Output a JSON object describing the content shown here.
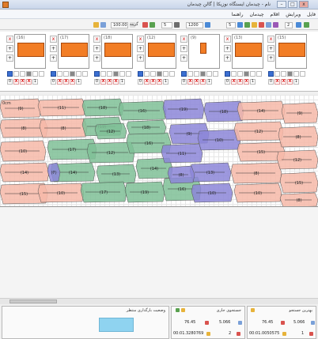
{
  "titlebar": {
    "title": "نام - چیدمان  ایستگاه  نوزیکا  | گالن چیدمان",
    "minimize": "–",
    "maximize": "□",
    "close": "x"
  },
  "menu": [
    "فایل",
    "ویرایش",
    "اقلام",
    "چیدمان",
    "راهنما"
  ],
  "toolbar": {
    "zoom_value": "100.00",
    "zoom_label": "گزینه",
    "field_2": "5",
    "field_3": "1200",
    "field_4": "5",
    "page_value": "2"
  },
  "pieces": [
    {
      "num": "(16)",
      "count_a": "0",
      "count_b": "1"
    },
    {
      "num": "(17)",
      "count_a": "0",
      "count_b": "1"
    },
    {
      "num": "(18)",
      "count_a": "0",
      "count_b": "1"
    },
    {
      "num": "(12)",
      "count_a": "0",
      "count_b": "1"
    },
    {
      "num": "(9)",
      "count_a": "0",
      "count_b": "1"
    },
    {
      "num": "(13)",
      "count_a": "0",
      "count_b": "1"
    },
    {
      "num": "(15)",
      "count_a": "0",
      "count_b": "1"
    }
  ],
  "marker": {
    "width_label": "0cm",
    "labels_salmon": [
      "(9)",
      "(8)",
      "(10)",
      "(14)",
      "(15)",
      "(11)",
      "(8)",
      "(10)",
      "(14)",
      "(12)",
      "(15)",
      "(8)",
      "(10)",
      "(9)",
      "(8)"
    ],
    "labels_green": [
      "(18)",
      "(19)",
      "(16)",
      "(17)",
      "(12)",
      "(14)",
      "(16)",
      "(13)",
      "(14)",
      "(17)",
      "(19)",
      "(18)",
      "(12)",
      "(16)"
    ],
    "labels_purple": [
      "(19)",
      "(18)",
      "(9)",
      "(11)",
      "(10)",
      "(13)",
      "(10)",
      "(8)",
      "(7)"
    ]
  },
  "status": {
    "left_panel_title": "وضعیت بارگذاری   منتظر",
    "mid_panel_title": "جستجوی جاری",
    "mid_efficiency": "76.45",
    "mid_length": "5.066",
    "mid_time": "00:01.3280769",
    "mid_count": "2",
    "right_panel_title": "بهترین جستجو",
    "right_efficiency": "76.45",
    "right_length": "5.066",
    "right_time": "00:01.0050575",
    "right_count": "1"
  },
  "colors": {
    "piece_orange": "#f27d25",
    "salmon": "#f6b8a8",
    "green": "#7fbf97",
    "purple": "#8c86d8",
    "status_color": "#8fd3f0"
  }
}
